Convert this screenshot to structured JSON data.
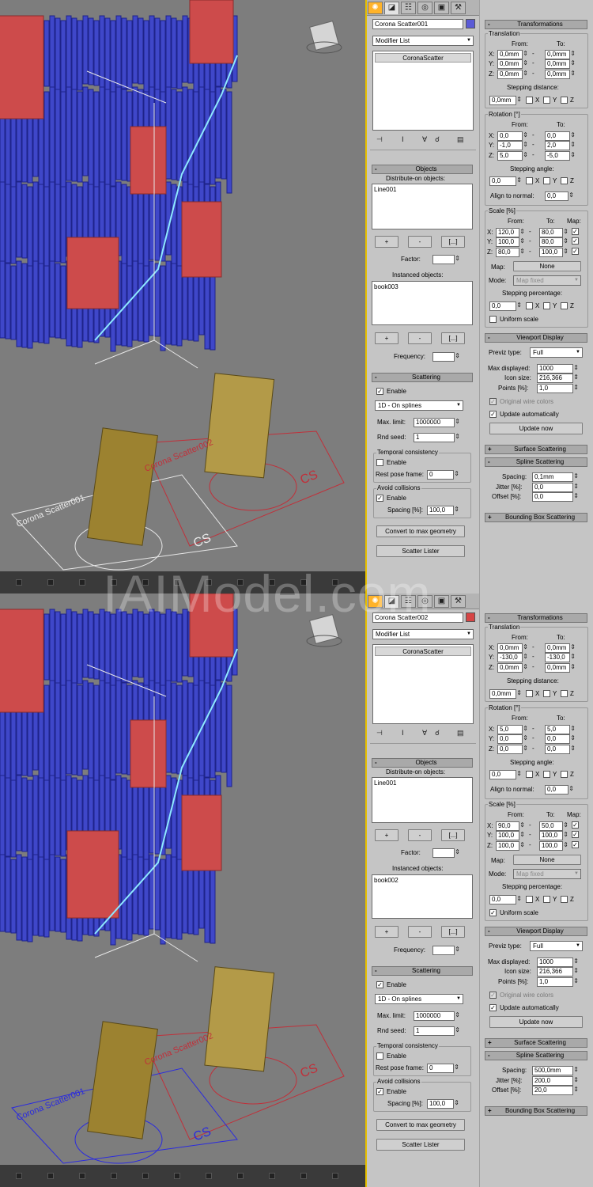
{
  "watermark": "IAIModel.com",
  "colors": {
    "books": "#3f47c9",
    "cards": "#cd4b4b",
    "accent": "#e6c000",
    "swatch1": "#5b5bd6",
    "swatch2": "#d64545"
  },
  "panels": [
    {
      "name_field": "Corona Scatter001",
      "modifier_list": "Modifier List",
      "stack_item": "CoronaScatter",
      "objects": {
        "title": "Objects",
        "distribute_label": "Distribute-on objects:",
        "distribute_item": "Line001",
        "plus": "+",
        "minus": "-",
        "ellipsis": "[...]",
        "factor_label": "Factor:",
        "instanced_label": "Instanced objects:",
        "instanced_item": "book003",
        "frequency_label": "Frequency:"
      },
      "scattering": {
        "title": "Scattering",
        "enable": "Enable",
        "mode": "1D - On splines",
        "max_limit_label": "Max. limit:",
        "max_limit": "1000000",
        "rnd_seed_label": "Rnd seed:",
        "rnd_seed": "1",
        "temporal_title": "Temporal consistency",
        "temporal_enable": "Enable",
        "rest_pose_label": "Rest pose frame:",
        "rest_pose": "0",
        "avoid_title": "Avoid collisions",
        "avoid_enable": "Enable",
        "spacing_label": "Spacing [%]:",
        "spacing": "100,0",
        "convert_btn": "Convert to max geometry",
        "lister_btn": "Scatter Lister"
      },
      "transform": {
        "title": "Transformations",
        "translation": "Translation",
        "from": "From:",
        "to": "To:",
        "tx": [
          "0,0mm",
          "0,0mm"
        ],
        "ty": [
          "0,0mm",
          "0,0mm"
        ],
        "tz": [
          "0,0mm",
          "0,0mm"
        ],
        "stepping_distance": "Stepping distance:",
        "step_dist": "0,0mm",
        "rotation": "Rotation [°]",
        "rx": [
          "0,0",
          "0,0"
        ],
        "ry": [
          "-1,0",
          "2,0"
        ],
        "rz": [
          "5,0",
          "-5,0"
        ],
        "stepping_angle": "Stepping angle:",
        "step_angle": "0,0",
        "align_normal": "Align to normal:",
        "align_val": "0,0",
        "scale": "Scale [%]",
        "map": "Map:",
        "sx": [
          "120,0",
          "80,0"
        ],
        "sy": [
          "100,0",
          "80,0"
        ],
        "sz": [
          "80,0",
          "100,0"
        ],
        "map_label": "Map:",
        "map_btn": "None",
        "mode_label": "Mode:",
        "mode_val": "Map fixed",
        "stepping_pct": "Stepping percentage:",
        "step_pct": "0,0",
        "uniform": "Uniform scale",
        "uniform_checked": false,
        "axis_x": "X",
        "axis_y": "Y",
        "axis_z": "Z",
        "axis_xc": "X:",
        "axis_yc": "Y:",
        "axis_zc": "Z:"
      },
      "viewport": {
        "title": "Viewport Display",
        "previz_label": "Previz type:",
        "previz": "Full",
        "max_disp_label": "Max displayed:",
        "max_disp": "1000",
        "icon_size_label": "Icon size:",
        "icon_size": "216,366",
        "points_label": "Points [%]:",
        "points": "1,0",
        "orig_wire": "Original wire colors",
        "update_auto": "Update automatically",
        "update_now": "Update now"
      },
      "surface": "Surface Scattering",
      "spline": {
        "title": "Spline Scattering",
        "spacing_label": "Spacing:",
        "spacing": "0,1mm",
        "jitter_label": "Jitter [%]:",
        "jitter": "0,0",
        "offset_label": "Offset [%]:",
        "offset": "0,0"
      },
      "bbox": "Bounding Box Scattering",
      "vp_labels": {
        "a": "Corona Scatter002",
        "b": "Corona Scatter001",
        "cs": "CS"
      }
    },
    {
      "name_field": "Corona Scatter002",
      "modifier_list": "Modifier List",
      "stack_item": "CoronaScatter",
      "objects": {
        "title": "Objects",
        "distribute_label": "Distribute-on objects:",
        "distribute_item": "Line001",
        "plus": "+",
        "minus": "-",
        "ellipsis": "[...]",
        "factor_label": "Factor:",
        "instanced_label": "Instanced objects:",
        "instanced_item": "book002",
        "frequency_label": "Frequency:"
      },
      "scattering": {
        "title": "Scattering",
        "enable": "Enable",
        "mode": "1D - On splines",
        "max_limit_label": "Max. limit:",
        "max_limit": "1000000",
        "rnd_seed_label": "Rnd seed:",
        "rnd_seed": "1",
        "temporal_title": "Temporal consistency",
        "temporal_enable": "Enable",
        "rest_pose_label": "Rest pose frame:",
        "rest_pose": "0",
        "avoid_title": "Avoid collisions",
        "avoid_enable": "Enable",
        "spacing_label": "Spacing [%]:",
        "spacing": "100,0",
        "convert_btn": "Convert to max geometry",
        "lister_btn": "Scatter Lister"
      },
      "transform": {
        "title": "Transformations",
        "translation": "Translation",
        "from": "From:",
        "to": "To:",
        "tx": [
          "0,0mm",
          "0,0mm"
        ],
        "ty": [
          "-130,0",
          "-130,0"
        ],
        "tz": [
          "0,0mm",
          "0,0mm"
        ],
        "stepping_distance": "Stepping distance:",
        "step_dist": "0,0mm",
        "rotation": "Rotation [°]",
        "rx": [
          "5,0",
          "5,0"
        ],
        "ry": [
          "0,0",
          "0,0"
        ],
        "rz": [
          "0,0",
          "0,0"
        ],
        "stepping_angle": "Stepping angle:",
        "step_angle": "0,0",
        "align_normal": "Align to normal:",
        "align_val": "0,0",
        "scale": "Scale [%]",
        "map": "Map:",
        "sx": [
          "90,0",
          "50,0"
        ],
        "sy": [
          "100,0",
          "100,0"
        ],
        "sz": [
          "100,0",
          "100,0"
        ],
        "map_label": "Map:",
        "map_btn": "None",
        "mode_label": "Mode:",
        "mode_val": "Map fixed",
        "stepping_pct": "Stepping percentage:",
        "step_pct": "0,0",
        "uniform": "Uniform scale",
        "uniform_checked": true,
        "axis_x": "X",
        "axis_y": "Y",
        "axis_z": "Z",
        "axis_xc": "X:",
        "axis_yc": "Y:",
        "axis_zc": "Z:"
      },
      "viewport": {
        "title": "Viewport Display",
        "previz_label": "Previz type:",
        "previz": "Full",
        "max_disp_label": "Max displayed:",
        "max_disp": "1000",
        "icon_size_label": "Icon size:",
        "icon_size": "216,366",
        "points_label": "Points [%]:",
        "points": "1,0",
        "orig_wire": "Original wire colors",
        "update_auto": "Update automatically",
        "update_now": "Update now"
      },
      "surface": "Surface Scattering",
      "spline": {
        "title": "Spline Scattering",
        "spacing_label": "Spacing:",
        "spacing": "500,0mm",
        "jitter_label": "Jitter [%]:",
        "jitter": "200,0",
        "offset_label": "Offset [%]:",
        "offset": "20,0"
      },
      "bbox": "Bounding Box Scattering",
      "vp_labels": {
        "a": "Corona Scatter002",
        "b": "Corona Scatter001",
        "cs": "CS"
      }
    }
  ]
}
